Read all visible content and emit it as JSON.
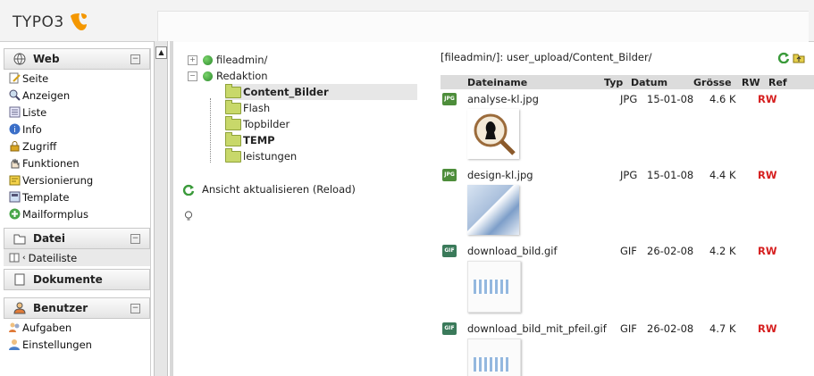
{
  "app": {
    "logo_text": "TYPO3",
    "brand_color": "#f49700"
  },
  "nav": {
    "web": {
      "label": "Web",
      "items": [
        "Seite",
        "Anzeigen",
        "Liste",
        "Info",
        "Zugriff",
        "Funktionen",
        "Versionierung",
        "Template",
        "Mailformplus"
      ]
    },
    "datei": {
      "label": "Datei",
      "items": [
        "Dateiliste"
      ]
    },
    "dokumente": {
      "label": "Dokumente"
    },
    "benutzer": {
      "label": "Benutzer",
      "items": [
        "Aufgaben",
        "Einstellungen"
      ]
    }
  },
  "tree": {
    "root1": "fileadmin/",
    "root2": "Redaktion",
    "children": [
      "Content_Bilder",
      "Flash",
      "Topbilder",
      "TEMP",
      "leistungen"
    ],
    "reload_label": "Ansicht aktualisieren (Reload)"
  },
  "filelist": {
    "path": "[fileadmin/]: user_upload/Content_Bilder/",
    "headers": {
      "name": "Dateiname",
      "typ": "Typ",
      "datum": "Datum",
      "groesse": "Grösse",
      "rw": "RW",
      "ref": "Ref"
    },
    "files": [
      {
        "name": "analyse-kl.jpg",
        "typ": "JPG",
        "datum": "15-01-08",
        "groesse": "4.6 K",
        "rw": "RW"
      },
      {
        "name": "design-kl.jpg",
        "typ": "JPG",
        "datum": "15-01-08",
        "groesse": "4.4 K",
        "rw": "RW"
      },
      {
        "name": "download_bild.gif",
        "typ": "GIF",
        "datum": "26-02-08",
        "groesse": "4.2 K",
        "rw": "RW"
      },
      {
        "name": "download_bild_mit_pfeil.gif",
        "typ": "GIF",
        "datum": "26-02-08",
        "groesse": "4.7 K",
        "rw": "RW"
      }
    ]
  }
}
